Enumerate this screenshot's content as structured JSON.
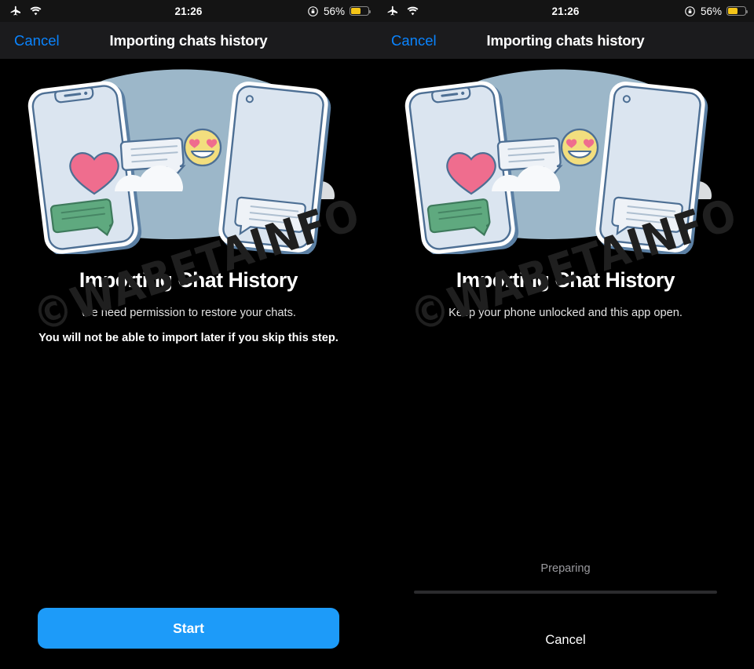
{
  "status_bar": {
    "airplane_icon": "airplane-mode-icon",
    "wifi_icon": "wifi-icon",
    "time": "21:26",
    "rotation_lock_icon": "rotation-lock-icon",
    "battery_percent": "56%",
    "battery_level": 56,
    "battery_color": "#f5c518"
  },
  "nav": {
    "cancel_label": "Cancel",
    "title": "Importing chats history",
    "accent_color": "#0a84ff"
  },
  "watermark": "©WABETAINFO",
  "illustration": {
    "name": "two-phones-chat-transfer-illustration",
    "blob_color": "#9cb7c9",
    "phone_body_color": "#dbe5f0",
    "phone_outline_color": "#4d6f94",
    "green_bubble_color": "#5fa97f",
    "heart_color": "#ef6d8e",
    "emoji_color": "#f2de7e",
    "cloud_color": "#f4f6f8"
  },
  "panels": [
    {
      "id": "permission-step",
      "headline": "Importing Chat History",
      "subline": "We need permission to restore your chats.",
      "warning": "You will not be able to import later if you skip this step.",
      "primary_button": "Start"
    },
    {
      "id": "progress-step",
      "headline": "Importing Chat History",
      "subline": "Keep your phone unlocked and this app open.",
      "progress_label": "Preparing",
      "progress_value": 0,
      "cancel_label": "Cancel"
    }
  ]
}
